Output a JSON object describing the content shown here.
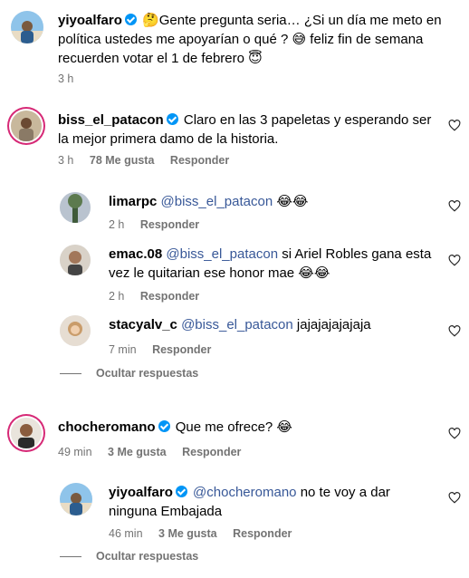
{
  "comments": [
    {
      "username": "yiyoalfaro",
      "verified": true,
      "text_parts": [
        "🤔Gente pregunta seria… ¿Si un día me meto en política ustedes me apoyarían o qué ? 😅 feliz fin de semana recuerden votar el 1 de febrero 😇"
      ],
      "time": "3 h",
      "likes": "",
      "reply_label": ""
    },
    {
      "username": "biss_el_patacon",
      "verified": true,
      "text": "Claro en las 3 papeletas y esperando ser la mejor primera damo de la historia.",
      "time": "3 h",
      "likes": "78 Me gusta",
      "reply_label": "Responder",
      "replies": [
        {
          "username": "limarpc",
          "mention": "@biss_el_patacon",
          "text": "😂😂",
          "time": "2 h",
          "reply_label": "Responder"
        },
        {
          "username": "emac.08",
          "mention": "@biss_el_patacon",
          "text": "si Ariel Robles gana esta vez le quitarian ese honor mae 😂😂",
          "time": "2 h",
          "reply_label": "Responder"
        },
        {
          "username": "stacyalv_c",
          "mention": "@biss_el_patacon",
          "text": "jajajajajajaja",
          "time": "7 min",
          "reply_label": "Responder"
        }
      ],
      "hide_replies": "Ocultar respuestas"
    },
    {
      "username": "chocheromano",
      "verified": true,
      "text": "Que me ofrece? 😂",
      "time": "49 min",
      "likes": "3 Me gusta",
      "reply_label": "Responder",
      "replies": [
        {
          "username": "yiyoalfaro",
          "verified": true,
          "mention": "@chocheromano",
          "text": "no te voy a dar ninguna Embajada",
          "time": "46 min",
          "likes": "3 Me gusta",
          "reply_label": "Responder"
        }
      ],
      "hide_replies": "Ocultar respuestas"
    }
  ],
  "icons": {
    "verified": "verified-badge-icon",
    "like": "heart-outline-icon"
  },
  "colors": {
    "verified": "#0095f6",
    "mention": "#385898",
    "meta": "#737373"
  }
}
